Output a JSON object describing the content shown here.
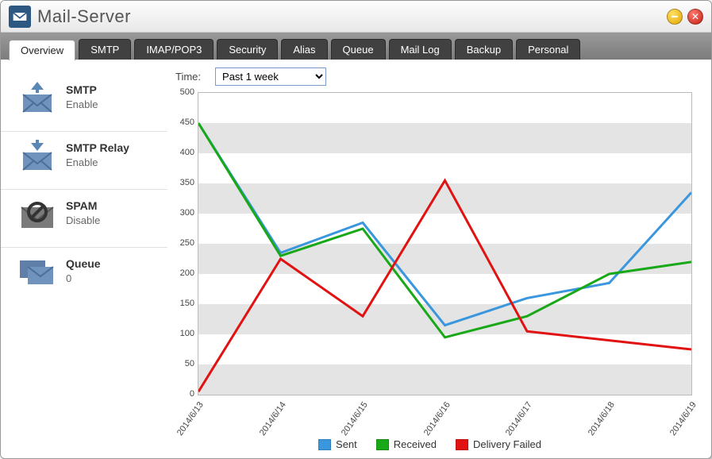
{
  "window": {
    "title": "Mail-Server"
  },
  "tabs": [
    {
      "label": "Overview",
      "active": true
    },
    {
      "label": "SMTP"
    },
    {
      "label": "IMAP/POP3"
    },
    {
      "label": "Security"
    },
    {
      "label": "Alias"
    },
    {
      "label": "Queue"
    },
    {
      "label": "Mail Log"
    },
    {
      "label": "Backup"
    },
    {
      "label": "Personal"
    }
  ],
  "time": {
    "label": "Time:",
    "selected": "Past 1 week"
  },
  "sidebar": [
    {
      "icon": "mail-up-icon",
      "label": "SMTP",
      "status": "Enable"
    },
    {
      "icon": "mail-down-icon",
      "label": "SMTP Relay",
      "status": "Enable"
    },
    {
      "icon": "spam-icon",
      "label": "SPAM",
      "status": "Disable"
    },
    {
      "icon": "queue-icon",
      "label": "Queue",
      "status": "0"
    }
  ],
  "colors": {
    "sent": "#3a96dd",
    "received": "#18a818",
    "failed": "#e11212",
    "band": "#e4e4e4"
  },
  "chart_data": {
    "type": "line",
    "title": "",
    "xlabel": "",
    "ylabel": "",
    "ylim": [
      0,
      500
    ],
    "yticks": [
      0,
      50,
      100,
      150,
      200,
      250,
      300,
      350,
      400,
      450,
      500
    ],
    "categories": [
      "2014/6/13",
      "2014/6/14",
      "2014/6/15",
      "2014/6/16",
      "2014/6/17",
      "2014/6/18",
      "2014/6/19"
    ],
    "series": [
      {
        "name": "Sent",
        "color": "#3a96dd",
        "values": [
          450,
          235,
          285,
          115,
          160,
          185,
          335
        ]
      },
      {
        "name": "Received",
        "color": "#18a818",
        "values": [
          450,
          230,
          275,
          95,
          130,
          200,
          220
        ]
      },
      {
        "name": "Delivery Failed",
        "color": "#e11212",
        "values": [
          5,
          225,
          130,
          355,
          105,
          90,
          75
        ]
      }
    ],
    "legend_position": "bottom"
  }
}
